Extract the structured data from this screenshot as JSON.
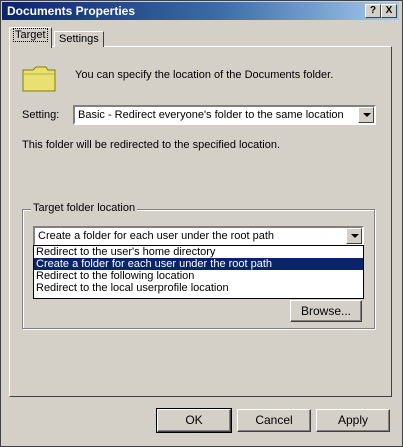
{
  "window": {
    "title": "Documents Properties",
    "help_label": "?",
    "close_label": "X"
  },
  "tabs": [
    {
      "label": "Target",
      "active": true
    },
    {
      "label": "Settings",
      "active": false
    }
  ],
  "intro_text": "You can specify the location of the Documents folder.",
  "setting": {
    "label": "Setting:",
    "value": "Basic - Redirect everyone's folder to the same location"
  },
  "redirect_info": "This folder will be redirected to the specified location.",
  "target_group": {
    "title": "Target folder location",
    "selected_value": "Create a folder for each user under the root path",
    "options": [
      "Redirect to the user's home directory",
      "Create a folder for each user under the root path",
      "Redirect to the following location",
      "Redirect to the local userprofile location"
    ],
    "highlighted_index": 1,
    "browse_label": "Browse..."
  },
  "buttons": {
    "ok": "OK",
    "cancel": "Cancel",
    "apply": "Apply"
  },
  "colors": {
    "face": "#d4d0c8",
    "titlebar_start": "#0a246a",
    "selection": "#0a246a"
  },
  "icons": {
    "folder": "folder-icon",
    "dropdown": "chevron-down-icon"
  }
}
